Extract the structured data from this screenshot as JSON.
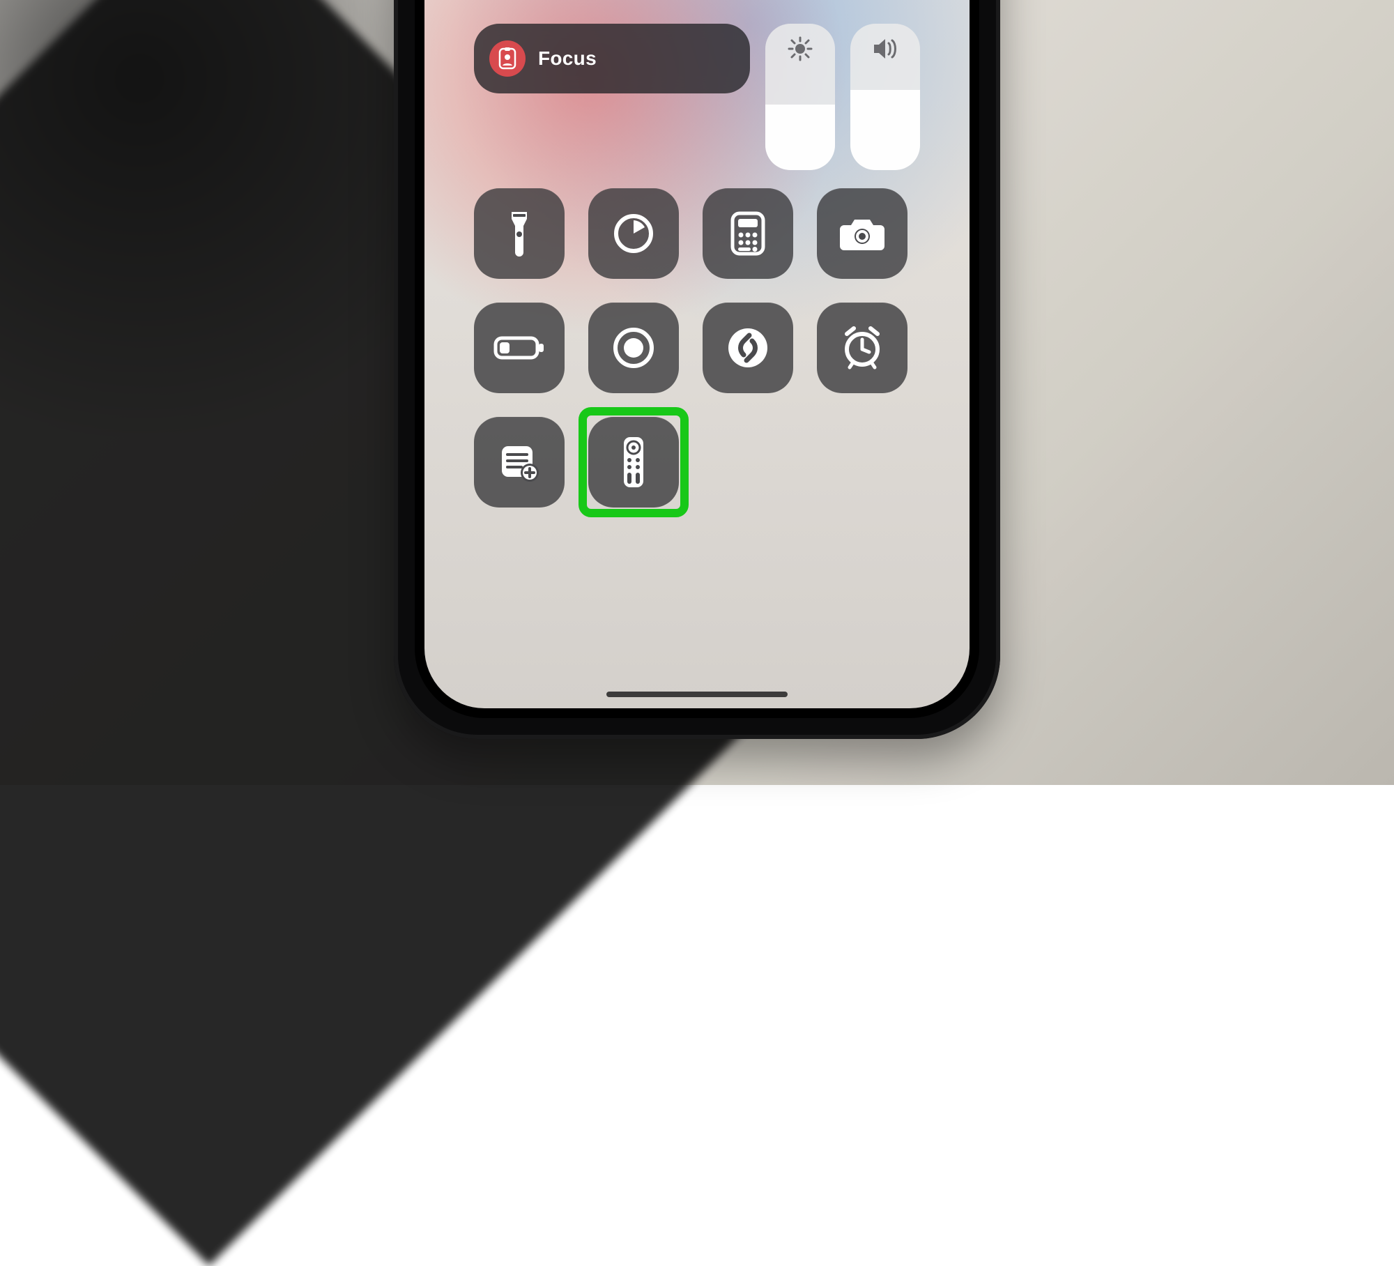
{
  "focus": {
    "label": "Focus",
    "icon": "id-badge-icon"
  },
  "sliders": [
    {
      "name": "brightness-slider",
      "icon": "sun-icon"
    },
    {
      "name": "volume-slider",
      "icon": "speaker-icon"
    }
  ],
  "tiles": [
    [
      {
        "name": "flashlight-button",
        "icon": "flashlight-icon"
      },
      {
        "name": "timer-button",
        "icon": "timer-icon"
      },
      {
        "name": "calculator-button",
        "icon": "calculator-icon"
      },
      {
        "name": "camera-button",
        "icon": "camera-icon"
      }
    ],
    [
      {
        "name": "low-power-mode-button",
        "icon": "battery-low-icon"
      },
      {
        "name": "screen-record-button",
        "icon": "record-circle-icon"
      },
      {
        "name": "shazam-button",
        "icon": "shazam-icon"
      },
      {
        "name": "alarm-button",
        "icon": "alarm-clock-icon"
      }
    ],
    [
      {
        "name": "quick-note-button",
        "icon": "note-add-icon"
      },
      {
        "name": "apple-tv-remote-button",
        "icon": "remote-icon",
        "highlighted": true
      }
    ]
  ],
  "annotation": {
    "color": "#18c818"
  }
}
